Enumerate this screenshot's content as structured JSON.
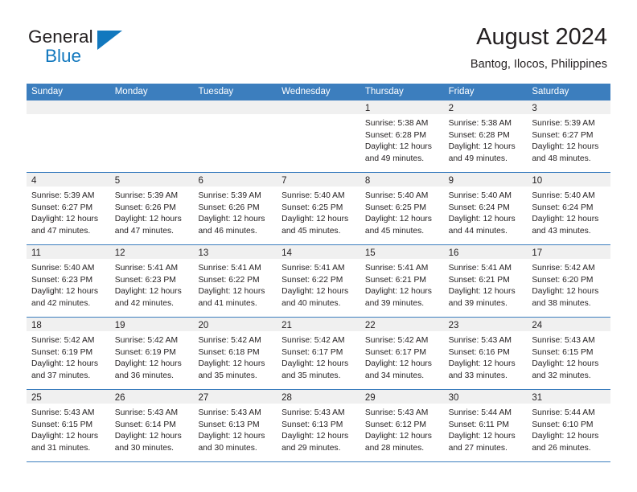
{
  "brand": {
    "name_top": "General",
    "name_bottom": "Blue",
    "accent_color": "#1278be",
    "logo_icon": "triangle-flag-icon"
  },
  "header": {
    "title": "August 2024",
    "subtitle": "Bantog, Ilocos, Philippines"
  },
  "theme": {
    "header_blue": "#3c7ebe",
    "daynum_band": "#f0f0f0",
    "text": "#231f20"
  },
  "calendar": {
    "weekday_headers": [
      "Sunday",
      "Monday",
      "Tuesday",
      "Wednesday",
      "Thursday",
      "Friday",
      "Saturday"
    ],
    "weeks": [
      [
        {
          "day": "",
          "lines": []
        },
        {
          "day": "",
          "lines": []
        },
        {
          "day": "",
          "lines": []
        },
        {
          "day": "",
          "lines": []
        },
        {
          "day": "1",
          "lines": [
            "Sunrise: 5:38 AM",
            "Sunset: 6:28 PM",
            "Daylight: 12 hours",
            "and 49 minutes."
          ]
        },
        {
          "day": "2",
          "lines": [
            "Sunrise: 5:38 AM",
            "Sunset: 6:28 PM",
            "Daylight: 12 hours",
            "and 49 minutes."
          ]
        },
        {
          "day": "3",
          "lines": [
            "Sunrise: 5:39 AM",
            "Sunset: 6:27 PM",
            "Daylight: 12 hours",
            "and 48 minutes."
          ]
        }
      ],
      [
        {
          "day": "4",
          "lines": [
            "Sunrise: 5:39 AM",
            "Sunset: 6:27 PM",
            "Daylight: 12 hours",
            "and 47 minutes."
          ]
        },
        {
          "day": "5",
          "lines": [
            "Sunrise: 5:39 AM",
            "Sunset: 6:26 PM",
            "Daylight: 12 hours",
            "and 47 minutes."
          ]
        },
        {
          "day": "6",
          "lines": [
            "Sunrise: 5:39 AM",
            "Sunset: 6:26 PM",
            "Daylight: 12 hours",
            "and 46 minutes."
          ]
        },
        {
          "day": "7",
          "lines": [
            "Sunrise: 5:40 AM",
            "Sunset: 6:25 PM",
            "Daylight: 12 hours",
            "and 45 minutes."
          ]
        },
        {
          "day": "8",
          "lines": [
            "Sunrise: 5:40 AM",
            "Sunset: 6:25 PM",
            "Daylight: 12 hours",
            "and 45 minutes."
          ]
        },
        {
          "day": "9",
          "lines": [
            "Sunrise: 5:40 AM",
            "Sunset: 6:24 PM",
            "Daylight: 12 hours",
            "and 44 minutes."
          ]
        },
        {
          "day": "10",
          "lines": [
            "Sunrise: 5:40 AM",
            "Sunset: 6:24 PM",
            "Daylight: 12 hours",
            "and 43 minutes."
          ]
        }
      ],
      [
        {
          "day": "11",
          "lines": [
            "Sunrise: 5:40 AM",
            "Sunset: 6:23 PM",
            "Daylight: 12 hours",
            "and 42 minutes."
          ]
        },
        {
          "day": "12",
          "lines": [
            "Sunrise: 5:41 AM",
            "Sunset: 6:23 PM",
            "Daylight: 12 hours",
            "and 42 minutes."
          ]
        },
        {
          "day": "13",
          "lines": [
            "Sunrise: 5:41 AM",
            "Sunset: 6:22 PM",
            "Daylight: 12 hours",
            "and 41 minutes."
          ]
        },
        {
          "day": "14",
          "lines": [
            "Sunrise: 5:41 AM",
            "Sunset: 6:22 PM",
            "Daylight: 12 hours",
            "and 40 minutes."
          ]
        },
        {
          "day": "15",
          "lines": [
            "Sunrise: 5:41 AM",
            "Sunset: 6:21 PM",
            "Daylight: 12 hours",
            "and 39 minutes."
          ]
        },
        {
          "day": "16",
          "lines": [
            "Sunrise: 5:41 AM",
            "Sunset: 6:21 PM",
            "Daylight: 12 hours",
            "and 39 minutes."
          ]
        },
        {
          "day": "17",
          "lines": [
            "Sunrise: 5:42 AM",
            "Sunset: 6:20 PM",
            "Daylight: 12 hours",
            "and 38 minutes."
          ]
        }
      ],
      [
        {
          "day": "18",
          "lines": [
            "Sunrise: 5:42 AM",
            "Sunset: 6:19 PM",
            "Daylight: 12 hours",
            "and 37 minutes."
          ]
        },
        {
          "day": "19",
          "lines": [
            "Sunrise: 5:42 AM",
            "Sunset: 6:19 PM",
            "Daylight: 12 hours",
            "and 36 minutes."
          ]
        },
        {
          "day": "20",
          "lines": [
            "Sunrise: 5:42 AM",
            "Sunset: 6:18 PM",
            "Daylight: 12 hours",
            "and 35 minutes."
          ]
        },
        {
          "day": "21",
          "lines": [
            "Sunrise: 5:42 AM",
            "Sunset: 6:17 PM",
            "Daylight: 12 hours",
            "and 35 minutes."
          ]
        },
        {
          "day": "22",
          "lines": [
            "Sunrise: 5:42 AM",
            "Sunset: 6:17 PM",
            "Daylight: 12 hours",
            "and 34 minutes."
          ]
        },
        {
          "day": "23",
          "lines": [
            "Sunrise: 5:43 AM",
            "Sunset: 6:16 PM",
            "Daylight: 12 hours",
            "and 33 minutes."
          ]
        },
        {
          "day": "24",
          "lines": [
            "Sunrise: 5:43 AM",
            "Sunset: 6:15 PM",
            "Daylight: 12 hours",
            "and 32 minutes."
          ]
        }
      ],
      [
        {
          "day": "25",
          "lines": [
            "Sunrise: 5:43 AM",
            "Sunset: 6:15 PM",
            "Daylight: 12 hours",
            "and 31 minutes."
          ]
        },
        {
          "day": "26",
          "lines": [
            "Sunrise: 5:43 AM",
            "Sunset: 6:14 PM",
            "Daylight: 12 hours",
            "and 30 minutes."
          ]
        },
        {
          "day": "27",
          "lines": [
            "Sunrise: 5:43 AM",
            "Sunset: 6:13 PM",
            "Daylight: 12 hours",
            "and 30 minutes."
          ]
        },
        {
          "day": "28",
          "lines": [
            "Sunrise: 5:43 AM",
            "Sunset: 6:13 PM",
            "Daylight: 12 hours",
            "and 29 minutes."
          ]
        },
        {
          "day": "29",
          "lines": [
            "Sunrise: 5:43 AM",
            "Sunset: 6:12 PM",
            "Daylight: 12 hours",
            "and 28 minutes."
          ]
        },
        {
          "day": "30",
          "lines": [
            "Sunrise: 5:44 AM",
            "Sunset: 6:11 PM",
            "Daylight: 12 hours",
            "and 27 minutes."
          ]
        },
        {
          "day": "31",
          "lines": [
            "Sunrise: 5:44 AM",
            "Sunset: 6:10 PM",
            "Daylight: 12 hours",
            "and 26 minutes."
          ]
        }
      ]
    ]
  }
}
